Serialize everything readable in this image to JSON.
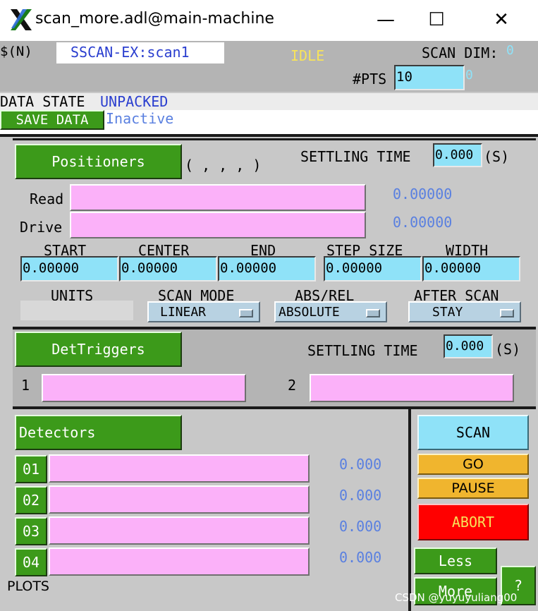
{
  "window": {
    "title": "scan_more.adl@main-machine",
    "minimize_glyph": "—",
    "maximize_glyph": "☐",
    "close_glyph": "✕"
  },
  "header": {
    "n_label": "$(N)",
    "record_name": "SSCAN-EX:scan1",
    "state": "IDLE",
    "scan_dim_label": "SCAN DIM:",
    "scan_dim_value": "0",
    "pts_label": "#PTS",
    "pts_value": "10",
    "pts_readback": "0"
  },
  "data_state": {
    "label": "DATA STATE",
    "value": "UNPACKED",
    "save_button": "SAVE DATA",
    "save_status": "Inactive"
  },
  "positioners": {
    "button": "Positioners",
    "list_text": "( , , , )",
    "settling_label": "SETTLING TIME",
    "settling_value": "0.000",
    "settling_unit": "(S)",
    "read_label": "Read",
    "drive_label": "Drive",
    "read_value": "0.00000",
    "drive_value": "0.00000",
    "columns": [
      {
        "label": "START",
        "value": "0.00000"
      },
      {
        "label": "CENTER",
        "value": "0.00000"
      },
      {
        "label": "END",
        "value": "0.00000"
      },
      {
        "label": "STEP SIZE",
        "value": "0.00000"
      },
      {
        "label": "WIDTH",
        "value": "0.00000"
      }
    ],
    "units_label": "UNITS",
    "scan_mode_label": "SCAN MODE",
    "scan_mode_value": "LINEAR",
    "abs_rel_label": "ABS/REL",
    "abs_rel_value": "ABSOLUTE",
    "after_scan_label": "AFTER SCAN",
    "after_scan_value": "STAY"
  },
  "triggers": {
    "button": "DetTriggers",
    "settling_label": "SETTLING TIME",
    "settling_value": "0.000",
    "settling_unit": "(S)",
    "t1_label": "1",
    "t2_label": "2"
  },
  "detectors": {
    "button": "Detectors",
    "rows": [
      {
        "id": "01",
        "value": "0.000"
      },
      {
        "id": "02",
        "value": "0.000"
      },
      {
        "id": "03",
        "value": "0.000"
      },
      {
        "id": "04",
        "value": "0.000"
      }
    ],
    "plots_label": "PLOTS"
  },
  "controls": {
    "scan": "SCAN",
    "go": "GO",
    "pause": "PAUSE",
    "abort": "ABORT",
    "less": "Less",
    "more": "More",
    "help": "?"
  },
  "watermark": "CSDN @yuyuyuliang00",
  "colors": {
    "green": "#3c9a1a",
    "cyan": "#8fe2f8",
    "pink": "#fbb1f9",
    "orange": "#f0b52e",
    "red": "#ff0000",
    "gray": "#c8c8c8"
  }
}
